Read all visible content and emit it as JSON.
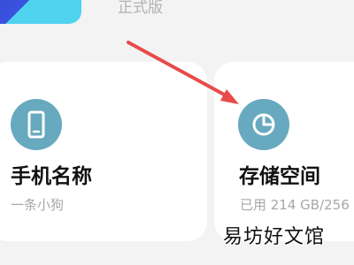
{
  "header": {
    "version_subtitle": "正式版"
  },
  "cards": {
    "phone_name": {
      "icon": "phone-icon",
      "title": "手机名称",
      "value": "一条小狗"
    },
    "storage": {
      "icon": "pie-chart-icon",
      "title": "存储空间",
      "value": "已用 214 GB/256"
    }
  },
  "annotation": {
    "arrow_color": "#e94a4a"
  },
  "watermark": {
    "text": "易坊好文馆"
  },
  "colors": {
    "background": "#f3f3f3",
    "card": "#ffffff",
    "icon_circle": "#67a9bf",
    "title": "#111111",
    "subtitle": "#a7a7a7"
  }
}
